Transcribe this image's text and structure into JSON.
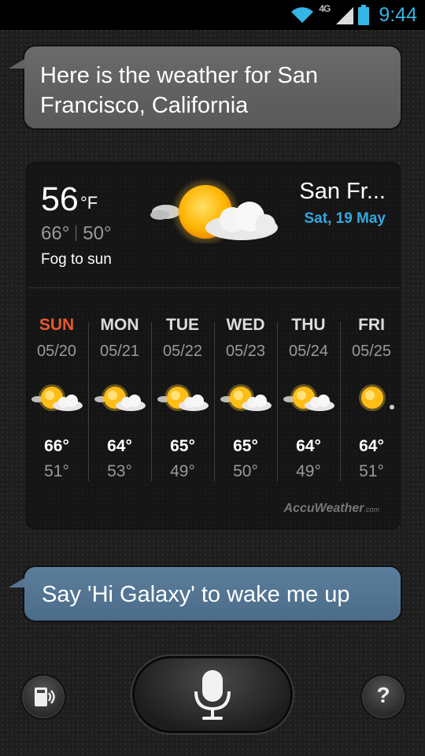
{
  "status_bar": {
    "network": "4G",
    "time": "9:44",
    "colors": {
      "accent": "#35b5e5"
    }
  },
  "conversation": {
    "response": "Here is the weather for San Francisco, California",
    "prompt": "Say 'Hi Galaxy' to wake me up"
  },
  "weather": {
    "current_temp": "56",
    "unit": "°F",
    "high": "66°",
    "low": "50°",
    "condition": "Fog to sun",
    "city": "San Fr...",
    "date": "Sat, 19 May",
    "icon": "sun-cloud-icon",
    "forecast": [
      {
        "day": "SUN",
        "date": "05/20",
        "high": "66°",
        "low": "51°",
        "icon": "sun-cloud-icon"
      },
      {
        "day": "MON",
        "date": "05/21",
        "high": "64°",
        "low": "53°",
        "icon": "sun-cloud-icon"
      },
      {
        "day": "TUE",
        "date": "05/22",
        "high": "65°",
        "low": "49°",
        "icon": "sun-cloud-icon"
      },
      {
        "day": "WED",
        "date": "05/23",
        "high": "65°",
        "low": "50°",
        "icon": "sun-cloud-icon"
      },
      {
        "day": "THU",
        "date": "05/24",
        "high": "64°",
        "low": "49°",
        "icon": "sun-cloud-icon"
      },
      {
        "day": "FRI",
        "date": "05/25",
        "high": "64°",
        "low": "51°",
        "icon": "sun-icon"
      }
    ],
    "provider": "AccuWeather",
    "provider_suffix": ".com"
  },
  "controls": {
    "help_label": "?",
    "mic_icon": "microphone-icon",
    "voice_output_icon": "speaker-phone-icon"
  }
}
